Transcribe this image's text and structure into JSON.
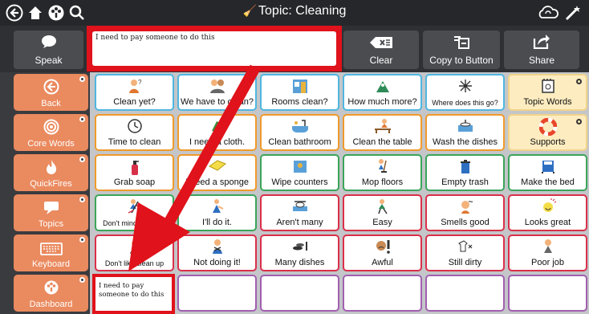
{
  "topbar": {
    "title": "Topic: Cleaning",
    "icons": [
      "back-circle-icon",
      "home-icon",
      "dashboard-icon",
      "search-icon",
      "sync-icon",
      "edit-wand-icon"
    ]
  },
  "toolbar": {
    "speak_label": "Speak",
    "message_text": "I need to pay someone to do this",
    "clear_label": "Clear",
    "copy_label": "Copy to Button",
    "share_label": "Share"
  },
  "side": [
    {
      "label": "Back",
      "icon": "back-arrow-icon"
    },
    {
      "label": "Core Words",
      "icon": "target-icon"
    },
    {
      "label": "QuickFires",
      "icon": "fire-icon"
    },
    {
      "label": "Topics",
      "icon": "speech-bubble-icon"
    },
    {
      "label": "Keyboard",
      "icon": "keyboard-icon"
    },
    {
      "label": "Dashboard",
      "icon": "dashboard-icon"
    }
  ],
  "grid": {
    "row1": [
      "Clean yet?",
      "We have to clean?",
      "Rooms clean?",
      "How much more?",
      "Where does this go?",
      "Topic Words"
    ],
    "row2": [
      "Time to clean",
      "I need a cloth.",
      "Clean bathroom",
      "Clean the table",
      "Wash the dishes",
      "Supports"
    ],
    "row3": [
      "Grab soap",
      "I need a sponge",
      "Wipe counters",
      "Mop floors",
      "Empty trash",
      "Make the bed"
    ],
    "row4": [
      "Don't mind cleaning",
      "I'll do it.",
      "Aren't many",
      "Easy",
      "Smells good",
      "Looks great"
    ],
    "row5": [
      "Don't like clean up",
      "Not doing it!",
      "Many dishes",
      "Awful",
      "Still dirty",
      "Poor job"
    ],
    "new_button": "I need to pay someone to do this"
  },
  "colors": {
    "highlight": "#e0121b",
    "side_button": "#ea8a5f",
    "row1": "#4fb6e0",
    "row2": "#f09a2b",
    "row3": "#3aa55a",
    "row4": "#d9304a",
    "row6": "#a15fb0"
  }
}
